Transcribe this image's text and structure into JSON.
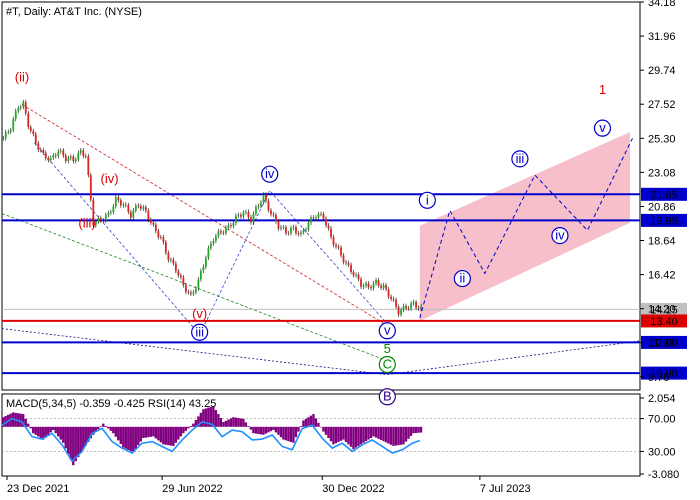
{
  "header": {
    "symbol_line": "#T, Daily:  AT&T Inc. (NYSE)",
    "indicator_line": "MACD(5,34,5) -0.359 -0.425 RSI(14) 43.25"
  },
  "chart_data": {
    "type": "candlestick",
    "title": "#T, Daily:  AT&T Inc. (NYSE)",
    "x_ticks": [
      "23 Dec 2021",
      "29 Jun 2022",
      "30 Dec 2022",
      "7 Jul 2023"
    ],
    "y_ticks": [
      "34.18",
      "31.96",
      "29.74",
      "27.52",
      "25.30",
      "23.08",
      "20.86",
      "18.64",
      "16.42",
      "14.20",
      "11.98",
      "9.76"
    ],
    "ylim": [
      8.9,
      34.18
    ],
    "price_series": {
      "name": "AT&T daily close (approx.)",
      "points": [
        [
          0,
          25.3
        ],
        [
          3,
          26.0
        ],
        [
          6,
          27.4
        ],
        [
          8,
          27.5
        ],
        [
          10,
          26.2
        ],
        [
          13,
          25.0
        ],
        [
          16,
          24.2
        ],
        [
          19,
          23.9
        ],
        [
          22,
          24.5
        ],
        [
          25,
          24.0
        ],
        [
          28,
          23.9
        ],
        [
          31,
          24.4
        ],
        [
          33,
          24.2
        ],
        [
          36,
          19.8
        ],
        [
          39,
          20.0
        ],
        [
          42,
          20.3
        ],
        [
          45,
          21.3
        ],
        [
          48,
          21.0
        ],
        [
          51,
          20.3
        ],
        [
          54,
          21.0
        ],
        [
          57,
          20.5
        ],
        [
          60,
          19.5
        ],
        [
          63,
          18.8
        ],
        [
          66,
          17.5
        ],
        [
          69,
          16.8
        ],
        [
          72,
          15.7
        ],
        [
          75,
          15.0
        ],
        [
          78,
          16.0
        ],
        [
          81,
          17.6
        ],
        [
          84,
          18.8
        ],
        [
          87,
          19.2
        ],
        [
          90,
          19.5
        ],
        [
          93,
          20.1
        ],
        [
          96,
          20.5
        ],
        [
          99,
          20.0
        ],
        [
          102,
          21.0
        ],
        [
          104,
          21.5
        ],
        [
          107,
          20.4
        ],
        [
          110,
          19.6
        ],
        [
          113,
          19.2
        ],
        [
          116,
          19.4
        ],
        [
          119,
          19.0
        ],
        [
          122,
          19.8
        ],
        [
          125,
          20.3
        ],
        [
          128,
          20.2
        ],
        [
          131,
          18.8
        ],
        [
          134,
          18.0
        ],
        [
          137,
          17.1
        ],
        [
          140,
          16.5
        ],
        [
          143,
          15.8
        ],
        [
          146,
          15.6
        ],
        [
          149,
          15.9
        ],
        [
          152,
          15.6
        ],
        [
          155,
          14.9
        ],
        [
          158,
          14.0
        ],
        [
          161,
          14.3
        ],
        [
          164,
          14.5
        ],
        [
          167,
          14.2
        ]
      ]
    },
    "horizontal_levels": [
      {
        "value": 21.65,
        "label": "21.65",
        "color": "#0000cc"
      },
      {
        "value": 19.95,
        "label": "19.95",
        "color": "#0000cc"
      },
      {
        "value": 14.15,
        "label": "14.15",
        "color": "#c0c0c0"
      },
      {
        "value": 13.4,
        "label": "13.40",
        "color": "#dd0000"
      },
      {
        "value": 12.0,
        "label": "12.00",
        "color": "#0000cc"
      },
      {
        "value": 10.0,
        "label": "10.00",
        "color": "#0000cc"
      }
    ],
    "forecast_channel": {
      "color": "#f5b4c1",
      "top": [
        [
          167,
          19.6
        ],
        [
          251,
          25.7
        ]
      ],
      "bottom": [
        [
          167,
          13.4
        ],
        [
          251,
          19.8
        ]
      ]
    },
    "forecast_path": {
      "color": "#0000cc",
      "points": [
        [
          167,
          13.6
        ],
        [
          179,
          20.6
        ],
        [
          193,
          16.5
        ],
        [
          213,
          22.9
        ],
        [
          234,
          19.3
        ],
        [
          252,
          25.3
        ]
      ]
    },
    "wave_labels": [
      {
        "text": "(ii)",
        "x": 8,
        "y": 29.0,
        "color": "#dd0000",
        "circle": false
      },
      {
        "text": "(iv)",
        "x": 43,
        "y": 22.4,
        "color": "#dd0000",
        "circle": false
      },
      {
        "text": "(iii)",
        "x": 34,
        "y": 19.5,
        "color": "#dd0000",
        "circle": false
      },
      {
        "text": "(v)",
        "x": 79,
        "y": 13.6,
        "color": "#dd0000",
        "circle": false
      },
      {
        "text": "iii",
        "x": 79,
        "y": 12.4,
        "color": "#0000cc",
        "circle": true
      },
      {
        "text": "iv",
        "x": 107,
        "y": 22.7,
        "color": "#0000cc",
        "circle": true
      },
      {
        "text": "v",
        "x": 154,
        "y": 12.5,
        "color": "#0000cc",
        "circle": true
      },
      {
        "text": "5",
        "x": 154,
        "y": 11.3,
        "color": "#008800",
        "circle": false
      },
      {
        "text": "C",
        "x": 154,
        "y": 10.3,
        "color": "#008800",
        "circle": true
      },
      {
        "text": "B",
        "x": 154,
        "y": 8.2,
        "color": "#330088",
        "circle": true
      },
      {
        "text": "i",
        "x": 170,
        "y": 21.0,
        "color": "#0000cc",
        "circle": true
      },
      {
        "text": "ii",
        "x": 184,
        "y": 15.9,
        "color": "#0000cc",
        "circle": true
      },
      {
        "text": "iii",
        "x": 207,
        "y": 23.7,
        "color": "#0000cc",
        "circle": true
      },
      {
        "text": "iv",
        "x": 223,
        "y": 18.7,
        "color": "#0000cc",
        "circle": true
      },
      {
        "text": "v",
        "x": 240,
        "y": 25.7,
        "color": "#0000cc",
        "circle": true
      },
      {
        "text": "1",
        "x": 240,
        "y": 28.2,
        "color": "#dd0000",
        "circle": false
      }
    ],
    "indicator_panel": {
      "y_ticks": [
        "2.054",
        "70.00",
        "30.00",
        "-3.080"
      ],
      "macd_ylim": [
        -3.08,
        2.054
      ],
      "rsi_ylim": [
        0,
        100
      ],
      "macd_color": "#800080",
      "rsi_color": "#1e90ff",
      "macd_hist": [
        [
          0,
          0.6
        ],
        [
          4,
          0.9
        ],
        [
          8,
          0.8
        ],
        [
          12,
          -0.4
        ],
        [
          16,
          -0.8
        ],
        [
          20,
          -0.2
        ],
        [
          24,
          -1.0
        ],
        [
          28,
          -2.4
        ],
        [
          32,
          -1.4
        ],
        [
          36,
          -0.5
        ],
        [
          40,
          0.2
        ],
        [
          44,
          -0.4
        ],
        [
          48,
          -1.3
        ],
        [
          52,
          -1.6
        ],
        [
          56,
          -0.7
        ],
        [
          60,
          -0.6
        ],
        [
          64,
          -1.1
        ],
        [
          68,
          -1.2
        ],
        [
          72,
          -0.4
        ],
        [
          76,
          0.2
        ],
        [
          80,
          1.1
        ],
        [
          84,
          1.3
        ],
        [
          88,
          0.3
        ],
        [
          92,
          0.6
        ],
        [
          96,
          0.5
        ],
        [
          100,
          -0.4
        ],
        [
          104,
          -0.5
        ],
        [
          108,
          -0.2
        ],
        [
          112,
          -0.8
        ],
        [
          116,
          -1.0
        ],
        [
          120,
          0.4
        ],
        [
          124,
          0.8
        ],
        [
          128,
          -0.3
        ],
        [
          132,
          -1.1
        ],
        [
          136,
          -0.8
        ],
        [
          140,
          -1.4
        ],
        [
          144,
          -1.0
        ],
        [
          148,
          -0.6
        ],
        [
          152,
          -0.9
        ],
        [
          156,
          -1.2
        ],
        [
          160,
          -1.1
        ],
        [
          164,
          -0.4
        ],
        [
          167,
          -0.36
        ]
      ],
      "rsi": [
        [
          0,
          62
        ],
        [
          4,
          70
        ],
        [
          8,
          66
        ],
        [
          12,
          48
        ],
        [
          16,
          45
        ],
        [
          20,
          52
        ],
        [
          24,
          38
        ],
        [
          28,
          18
        ],
        [
          32,
          30
        ],
        [
          36,
          52
        ],
        [
          40,
          58
        ],
        [
          44,
          42
        ],
        [
          48,
          34
        ],
        [
          52,
          28
        ],
        [
          56,
          40
        ],
        [
          60,
          42
        ],
        [
          64,
          36
        ],
        [
          68,
          30
        ],
        [
          72,
          44
        ],
        [
          76,
          56
        ],
        [
          80,
          66
        ],
        [
          84,
          63
        ],
        [
          88,
          48
        ],
        [
          92,
          56
        ],
        [
          96,
          54
        ],
        [
          100,
          44
        ],
        [
          104,
          45
        ],
        [
          108,
          50
        ],
        [
          112,
          36
        ],
        [
          116,
          32
        ],
        [
          120,
          58
        ],
        [
          124,
          62
        ],
        [
          128,
          46
        ],
        [
          132,
          34
        ],
        [
          136,
          40
        ],
        [
          140,
          30
        ],
        [
          144,
          38
        ],
        [
          148,
          44
        ],
        [
          152,
          36
        ],
        [
          156,
          28
        ],
        [
          160,
          32
        ],
        [
          164,
          40
        ],
        [
          167,
          43.25
        ]
      ]
    }
  }
}
